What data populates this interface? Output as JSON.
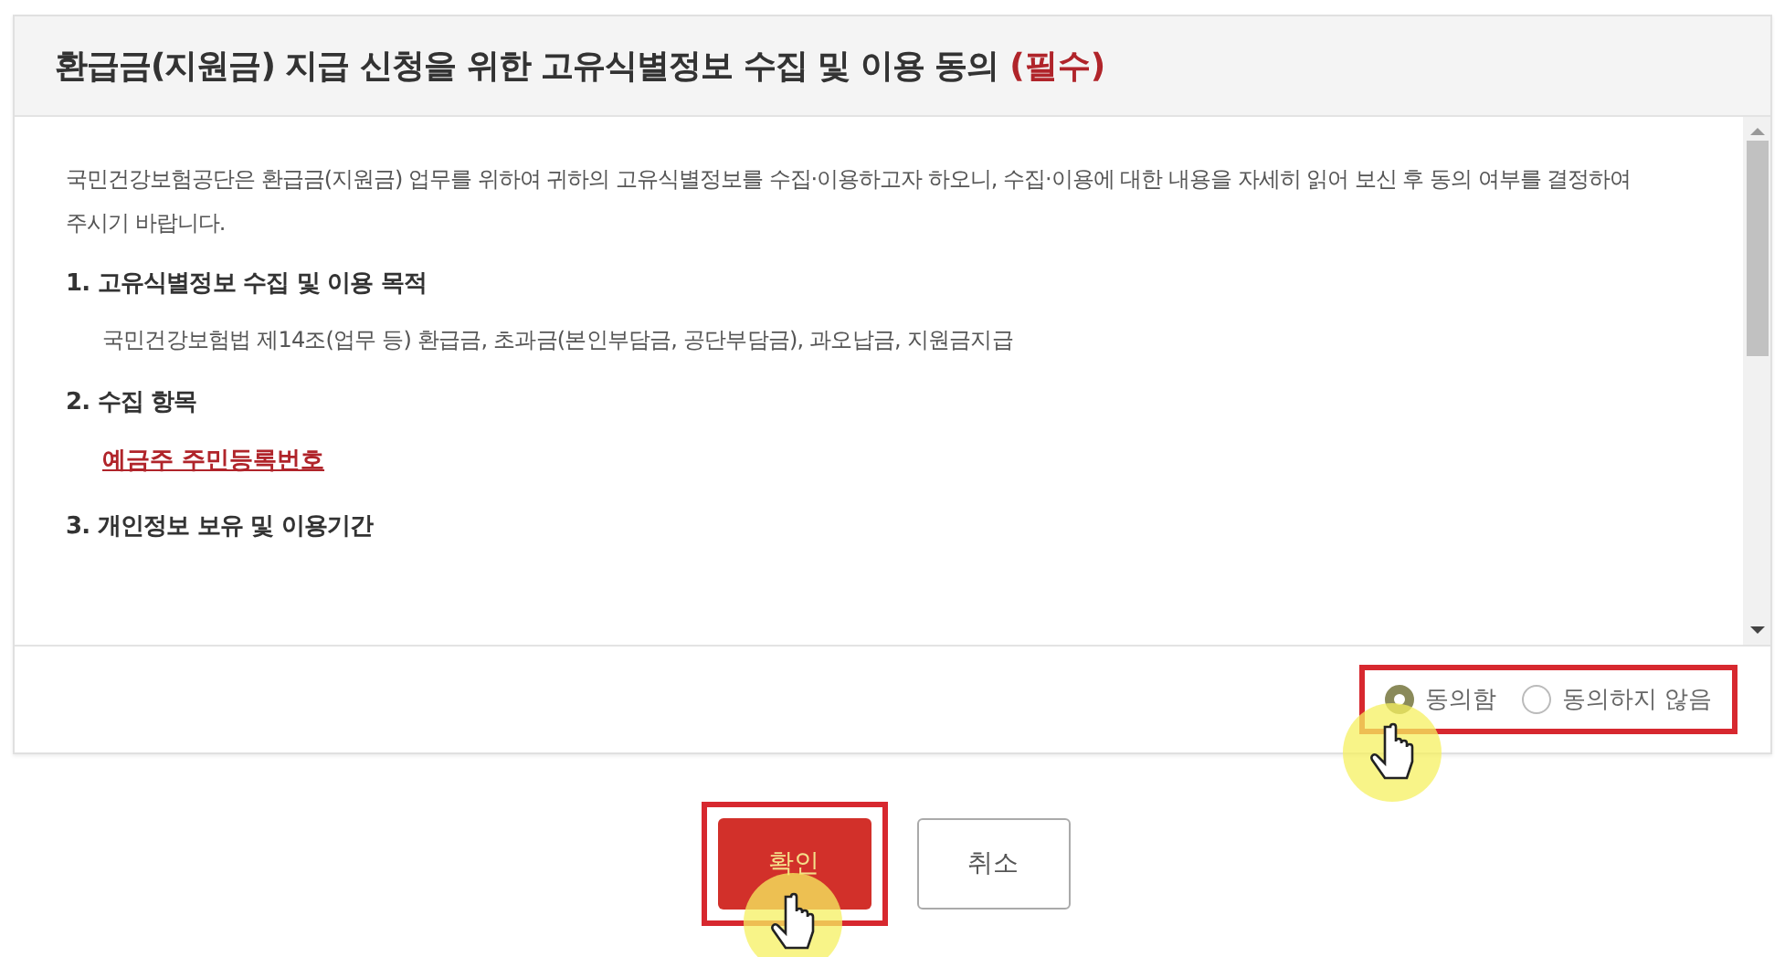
{
  "dialog": {
    "title": "환급금(지원금) 지급 신청을 위한 고유식별정보 수집 및 이용 동의",
    "required_mark": "(필수)"
  },
  "content": {
    "intro": "국민건강보험공단은 환급금(지원금) 업무를 위하여 귀하의 고유식별정보를 수집·이용하고자 하오니, 수집·이용에 대한 내용을 자세히 읽어 보신 후 동의 여부를 결정하여 주시기 바랍니다.",
    "sections": [
      {
        "heading": "1. 고유식별정보 수집 및 이용 목적",
        "body": "국민건강보험법 제14조(업무 등) 환급금, 초과금(본인부담금, 공단부담금), 과오납금, 지원금지급",
        "kind": "text"
      },
      {
        "heading": "2. 수집 항목",
        "body": "예금주 주민등록번호",
        "kind": "link"
      },
      {
        "heading": "3. 개인정보 보유 및 이용기간",
        "kind": "heading"
      }
    ]
  },
  "consent_highlighted": true,
  "consent": [
    {
      "label": "동의함",
      "selected": true
    },
    {
      "label": "동의하지 않음",
      "selected": false
    }
  ],
  "buttons": [
    {
      "label": "확인",
      "kind": "primary",
      "highlighted": true
    },
    {
      "label": "취소",
      "kind": "secondary",
      "highlighted": false
    }
  ]
}
